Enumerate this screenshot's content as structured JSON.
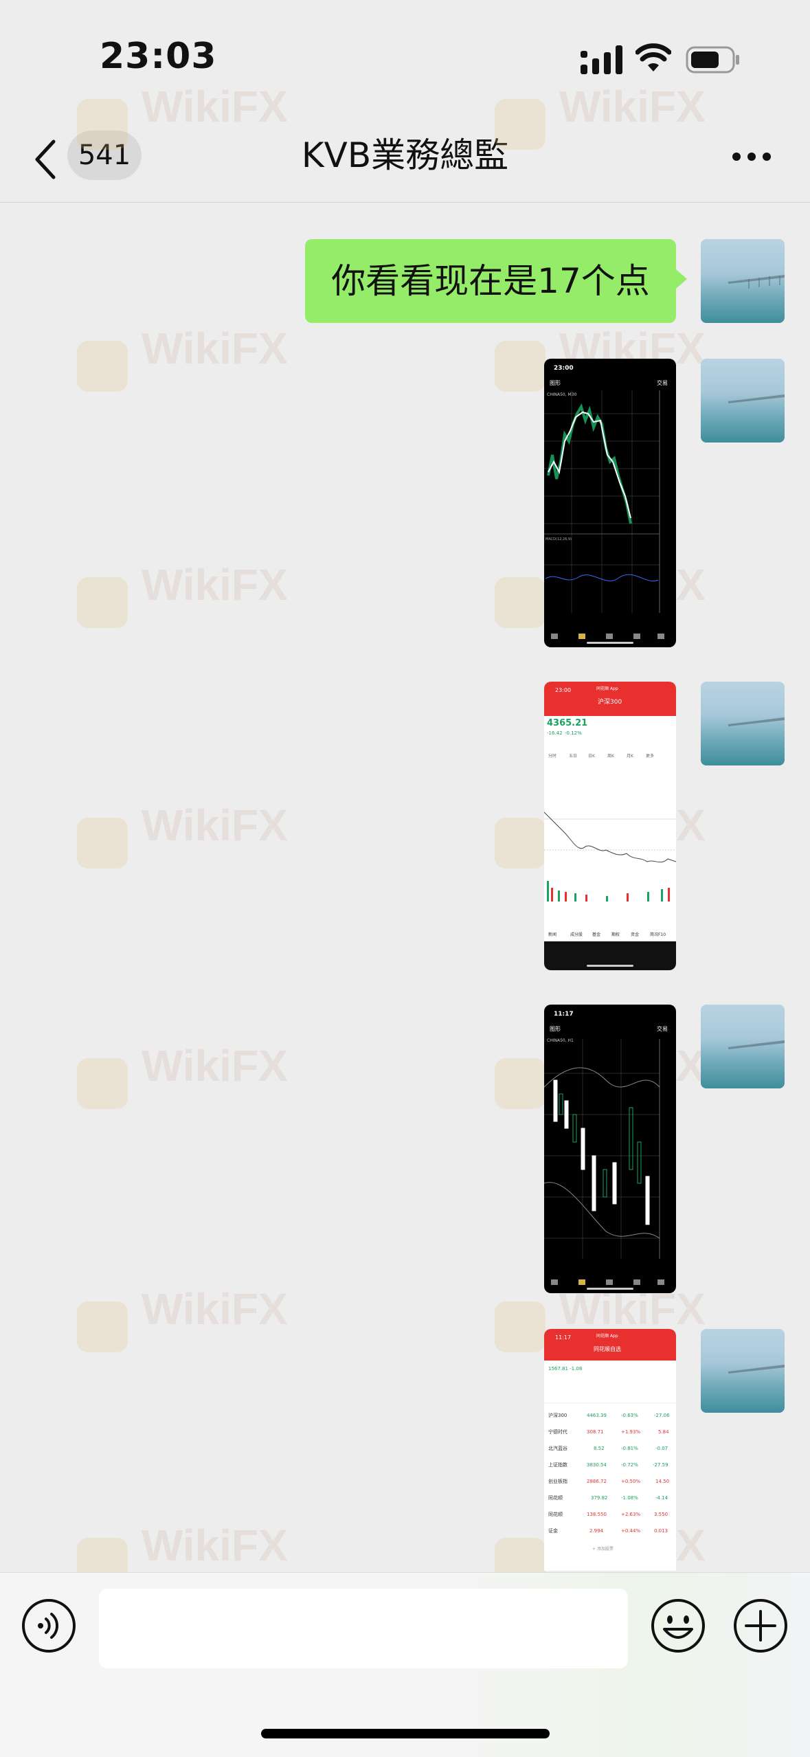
{
  "status_bar": {
    "time": "23:03",
    "icons": [
      "signal-icon",
      "wifi-icon",
      "battery-icon"
    ]
  },
  "header": {
    "back_icon": "chevron-left-icon",
    "unread_count": "541",
    "title": "KVB業務總監",
    "more_icon": "more-dots-icon"
  },
  "messages": [
    {
      "type": "text",
      "text": "你看看现在是17个点",
      "sender": "me"
    },
    {
      "type": "image",
      "sender": "me",
      "screenshot": {
        "time": "23:00",
        "left_label": "图形",
        "right_label": "交易",
        "symbol": "CHINA50, M30",
        "indicator": "MACD(12,26,9)"
      }
    },
    {
      "type": "image",
      "sender": "me",
      "screenshot": {
        "time": "23:00",
        "app": "同花顺 App",
        "index": "沪深300",
        "price": "4365.21",
        "change": "-16.42",
        "change_pct": "-0.12%",
        "tabs": [
          "分时",
          "五日",
          "日K",
          "周K",
          "月K",
          "更多"
        ],
        "bottom_tabs": [
          "新闻",
          "成分股",
          "基金",
          "期权",
          "资金",
          "简况F10"
        ]
      }
    },
    {
      "type": "image",
      "sender": "me",
      "screenshot": {
        "time": "11:17",
        "left_label": "图形",
        "right_label": "交易",
        "symbol": "CHINA50, H1"
      }
    },
    {
      "type": "image",
      "sender": "me",
      "screenshot": {
        "time": "11:17",
        "app": "同花顺 App",
        "title": "同花顺自选",
        "summary": "1567.81 -1.08",
        "rows": [
          {
            "name": "沪深300",
            "price": "4463.39",
            "pct": "-0.63%",
            "chg": "-27.06"
          },
          {
            "name": "宁德时代",
            "price": "308.71",
            "pct": "+1.93%",
            "chg": "5.84"
          },
          {
            "name": "北汽蓝谷",
            "price": "8.52",
            "pct": "-0.81%",
            "chg": "-0.07"
          },
          {
            "name": "上证指数",
            "price": "3830.54",
            "pct": "-0.72%",
            "chg": "-27.59"
          },
          {
            "name": "创业板指",
            "price": "2886.72",
            "pct": "+0.50%",
            "chg": "14.50"
          },
          {
            "name": "同花顺",
            "price": "379.82",
            "pct": "-1.08%",
            "chg": "-4.14"
          },
          {
            "name": "同花顺",
            "price": "138.550",
            "pct": "+2.63%",
            "chg": "3.550"
          },
          {
            "name": "证金",
            "price": "2.994",
            "pct": "+0.44%",
            "chg": "0.013"
          }
        ],
        "add_label": "+ 添加股票"
      }
    }
  ],
  "watermark": "WikiFX",
  "input_bar": {
    "placeholder": "",
    "voice_icon": "voice-icon",
    "emoji_icon": "emoji-icon",
    "plus_icon": "plus-circle-icon"
  },
  "colors": {
    "bubble": "#95ec69",
    "background": "#ededed",
    "up": "#e93030",
    "down": "#1aa260",
    "ths_red": "#e8312f"
  }
}
